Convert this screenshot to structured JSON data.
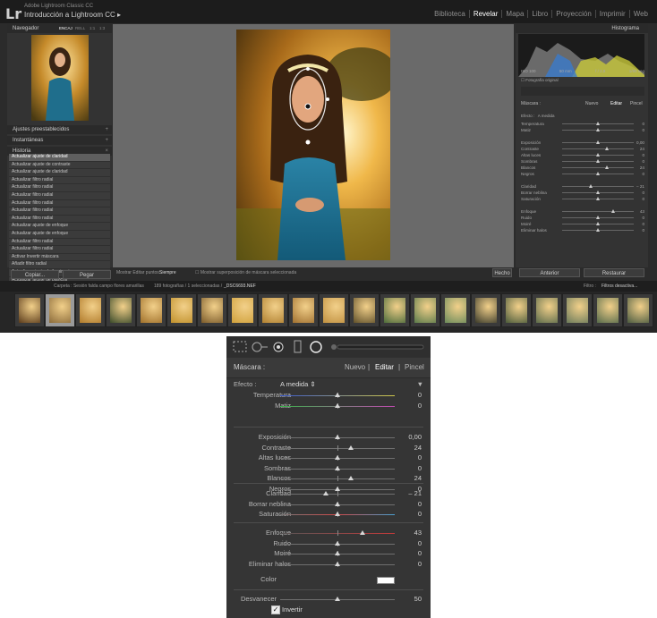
{
  "window": {
    "brand_line1": "Adobe Lightroom Classic CC",
    "brand_line2": "Introducción a Lightroom CC",
    "logo": "Lr",
    "modules": [
      "Biblioteca",
      "Revelar",
      "Mapa",
      "Libro",
      "Proyección",
      "Imprimir",
      "Web"
    ],
    "active_module": "Revelar"
  },
  "left_panel": {
    "navigator_title": "Navegador",
    "navigator_zoom": [
      "ENCAJ",
      "RELL",
      "1:1",
      "1:3"
    ],
    "presets_title": "Ajustes preestablecidos",
    "snapshots_title": "Instantáneas",
    "history_title": "Historia",
    "history": [
      "Actualizar ajuste de claridad",
      "Actualizar ajuste de contraste",
      "Actualizar ajuste de claridad",
      "Actualizar filtro radial",
      "Actualizar filtro radial",
      "Actualizar filtro radial",
      "Actualizar filtro radial",
      "Actualizar filtro radial",
      "Actualizar filtro radial",
      "Actualizar ajuste de enfoque",
      "Actualizar ajuste de enfoque",
      "Actualizar filtro radial",
      "Actualizar filtro radial",
      "Activar Invertir máscara",
      "Añadir filtro radial",
      "Actualizar ajuste de iluminaciones",
      "Actualizar ajuste de blancos",
      "Actualizar ajuste de temperatura de color"
    ],
    "copy_button": "Copiar...",
    "paste_button": "Pegar"
  },
  "toolbar": {
    "show_edit_pins_label": "Mostrar Editar puntos:",
    "show_edit_pins_value": "Siempre",
    "overlay_label": "Mostrar superposición de máscara seleccionada",
    "done_button": "Hecho"
  },
  "right_panel": {
    "histogram_title": "Histograma",
    "histogram_info": [
      "ISO 100",
      "50 mm",
      "f / 2,8",
      "1/80 seg"
    ],
    "original_photo": "Fotografía original",
    "mask_label": "Máscara :",
    "mask_new": "Nuevo",
    "mask_edit": "Editar",
    "mask_brush": "Pincel",
    "effect_label": "Efecto :",
    "effect_value": "A medida",
    "previous_button": "Anterior",
    "reset_button": "Restaurar"
  },
  "filmstrip": {
    "path_text": "Carpeta : Sesión falda campo flores amarillas",
    "count_text": "189 fotografías / 1 seleccionadas /",
    "filename": "_DSC6693.NEF",
    "filter_label": "Filtro :",
    "filter_value": "Filtros desactiva..."
  },
  "mask_panel": {
    "mask_label": "Máscara :",
    "new_label": "Nuevo",
    "edit_label": "Editar",
    "brush_label": "Pincel",
    "effect_label": "Efecto :",
    "effect_value": "A medida",
    "sliders_group1": [
      {
        "label": "Temperatura",
        "value": "0",
        "pos": 0.5
      },
      {
        "label": "Matiz",
        "value": "0",
        "pos": 0.5
      }
    ],
    "sliders_group2": [
      {
        "label": "Exposición",
        "value": "0,00",
        "pos": 0.5
      },
      {
        "label": "Contraste",
        "value": "24",
        "pos": 0.62
      },
      {
        "label": "Altas luces",
        "value": "0",
        "pos": 0.5
      },
      {
        "label": "Sombras",
        "value": "0",
        "pos": 0.5
      },
      {
        "label": "Blancos",
        "value": "24",
        "pos": 0.62
      },
      {
        "label": "Negros",
        "value": "0",
        "pos": 0.5
      }
    ],
    "sliders_group3": [
      {
        "label": "Claridad",
        "value": "– 21",
        "pos": 0.395
      },
      {
        "label": "Borrar neblina",
        "value": "0",
        "pos": 0.5
      },
      {
        "label": "Saturación",
        "value": "0",
        "pos": 0.5
      }
    ],
    "sliders_group4": [
      {
        "label": "Enfoque",
        "value": "43",
        "pos": 0.715
      },
      {
        "label": "Ruido",
        "value": "0",
        "pos": 0.5
      },
      {
        "label": "Moiré",
        "value": "0",
        "pos": 0.5
      },
      {
        "label": "Eliminar halos",
        "value": "0",
        "pos": 0.5
      }
    ],
    "color_label": "Color",
    "feather_label": "Desvanecer",
    "feather_value": "50",
    "feather_pos": 0.5,
    "invert_label": "Invertir",
    "invert_checked": true
  }
}
